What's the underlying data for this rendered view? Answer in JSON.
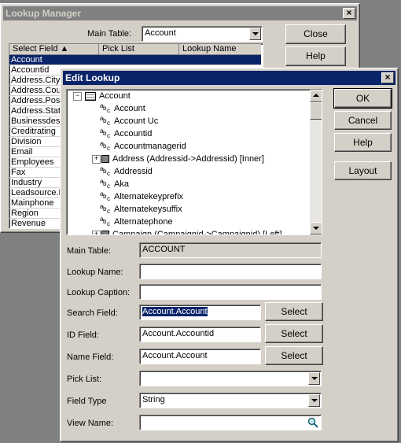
{
  "lookup_manager": {
    "title": "Lookup Manager",
    "main_table_label": "Main Table:",
    "main_table_value": "Account",
    "columns": [
      "Select Field ▲",
      "Pick List",
      "Lookup Name"
    ],
    "rows": [
      "Account",
      "Accountid",
      "Address.City",
      "Address.Coun",
      "Address.Post",
      "Address.State",
      "Businessdesc",
      "Creditrating",
      "Division",
      "Email",
      "Employees",
      "Fax",
      "Industry",
      "Leadsource.L",
      "Mainphone",
      "Region",
      "Revenue"
    ],
    "close_label": "Close",
    "help_label": "Help"
  },
  "edit_lookup": {
    "title": "Edit Lookup",
    "ok_label": "OK",
    "cancel_label": "Cancel",
    "help_label": "Help",
    "layout_label": "Layout",
    "tree_root": "Account",
    "tree_items": [
      {
        "text": "Account",
        "type": "field"
      },
      {
        "text": "Account Uc",
        "type": "field"
      },
      {
        "text": "Accountid",
        "type": "field"
      },
      {
        "text": "Accountmanagerid",
        "type": "field"
      },
      {
        "text": "Address (Addressid->Addressid) [Inner]",
        "type": "join"
      },
      {
        "text": "Addressid",
        "type": "field"
      },
      {
        "text": "Aka",
        "type": "field"
      },
      {
        "text": "Alternatekeyprefix",
        "type": "field"
      },
      {
        "text": "Alternatekeysuffix",
        "type": "field"
      },
      {
        "text": "Alternatephone",
        "type": "field"
      },
      {
        "text": "Campaign (Campaignid->Campaignid) [Left]",
        "type": "join"
      }
    ],
    "main_table_label": "Main Table:",
    "main_table_value": "ACCOUNT",
    "lookup_name_label": "Lookup Name:",
    "lookup_name_value": "",
    "lookup_caption_label": "Lookup Caption:",
    "lookup_caption_value": "",
    "search_field_label": "Search Field:",
    "search_field_value": "Account.Account",
    "id_field_label": "ID Field:",
    "id_field_value": "Account.Accountid",
    "name_field_label": "Name Field:",
    "name_field_value": "Account.Account",
    "select_label": "Select",
    "pick_list_label": "Pick List:",
    "pick_list_value": "",
    "field_type_label": "Field Type",
    "field_type_value": "String",
    "view_name_label": "View Name:",
    "view_name_value": ""
  }
}
